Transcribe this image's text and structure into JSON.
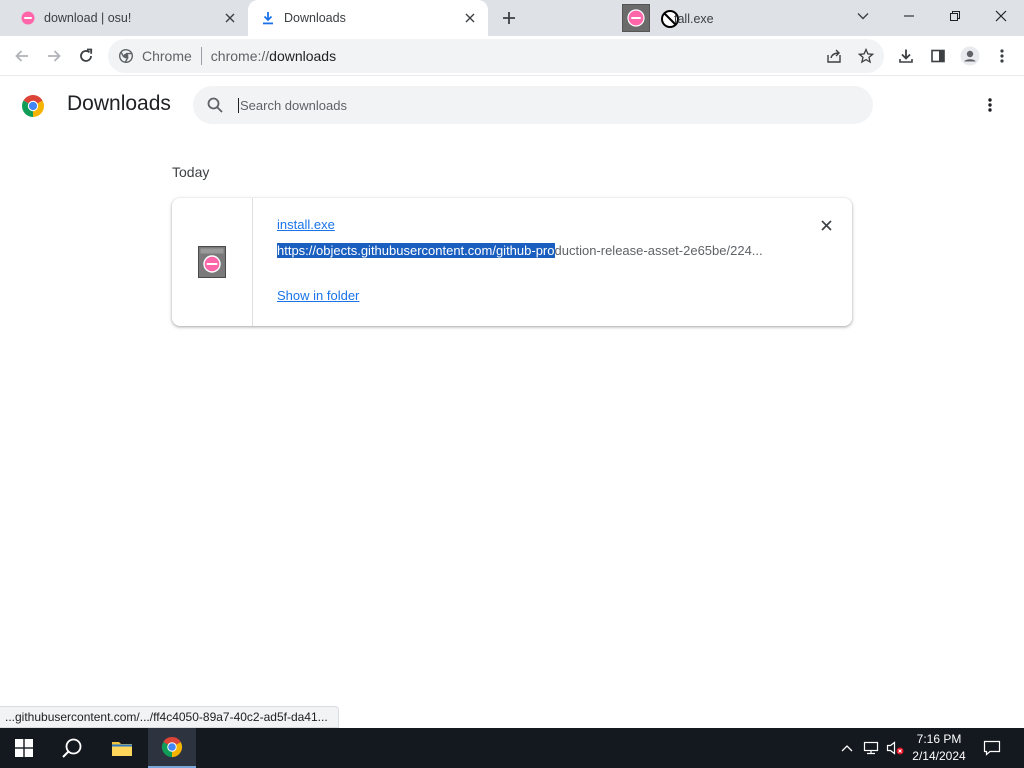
{
  "tabs": [
    {
      "title": "download | osu!",
      "favicon": "osu-icon",
      "active": false
    },
    {
      "title": "Downloads",
      "favicon": "download-icon",
      "active": true
    }
  ],
  "dragged_tab": {
    "label": "tall.exe"
  },
  "toolbar": {
    "site_label": "Chrome",
    "url_scheme": "chrome://",
    "url_host": "downloads"
  },
  "page": {
    "title": "Downloads",
    "search_placeholder": "Search downloads"
  },
  "downloads": {
    "date_header": "Today",
    "items": [
      {
        "filename": "install.exe",
        "url_selected": "https://objects.githubusercontent.com/github-pro",
        "url_rest": "duction-release-asset-2e65be/224...",
        "action": "Show in folder"
      }
    ]
  },
  "status_bar": {
    "text": "...githubusercontent.com/.../ff4c4050-89a7-40c2-ad5f-da41..."
  },
  "taskbar": {
    "time": "7:16 PM",
    "date": "2/14/2024"
  },
  "colors": {
    "accent": "#1a73e8",
    "tabstrip": "#dee1e6",
    "taskbar": "#14181f"
  }
}
